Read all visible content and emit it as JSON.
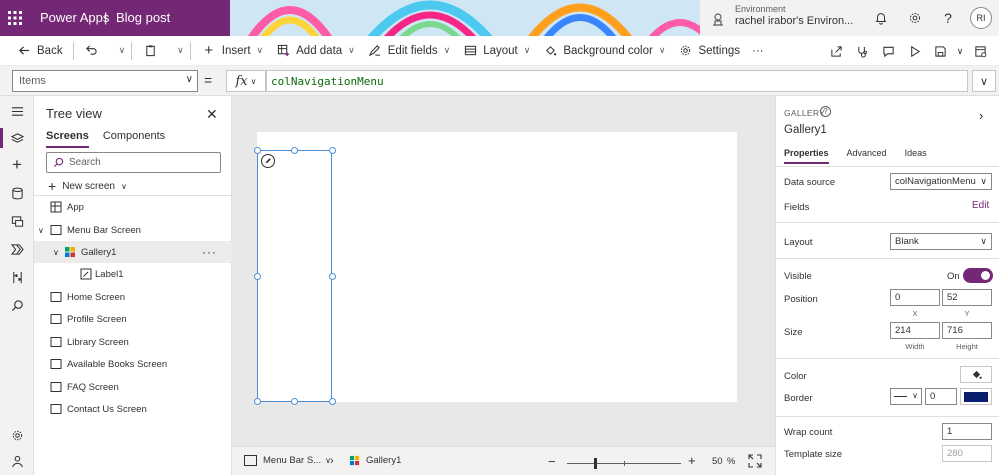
{
  "header": {
    "app_name": "Power Apps",
    "separator": "|",
    "doc_name": "Blog post",
    "environment_label": "Environment",
    "environment_value": "rachel irabor's Environ...",
    "avatar_initials": "RI",
    "brand_color": "#742774"
  },
  "commandbar": {
    "back": "Back",
    "insert": "Insert",
    "add_data": "Add data",
    "edit_fields": "Edit fields",
    "layout": "Layout",
    "background_color": "Background color",
    "settings": "Settings",
    "more": "···"
  },
  "formula": {
    "property": "Items",
    "equals": "=",
    "fx": "fx",
    "value": "colNavigationMenu"
  },
  "tree": {
    "title": "Tree view",
    "tabs": [
      "Screens",
      "Components"
    ],
    "search_placeholder": "Search",
    "new_screen": "New screen",
    "nodes": {
      "app": "App",
      "menu_bar_screen": "Menu Bar Screen",
      "gallery1": "Gallery1",
      "label1": "Label1",
      "home_screen": "Home Screen",
      "profile_screen": "Profile Screen",
      "library_screen": "Library Screen",
      "available_books_screen": "Available Books Screen",
      "faq_screen": "FAQ Screen",
      "contact_us_screen": "Contact Us Screen"
    },
    "more": "···"
  },
  "statusbar": {
    "screen_crumb": "Menu Bar S...",
    "control_crumb": "Gallery1",
    "zoom_value": "50",
    "zoom_unit": "%"
  },
  "properties": {
    "control_type": "GALLERY",
    "control_name": "Gallery1",
    "tabs": [
      "Properties",
      "Advanced",
      "Ideas"
    ],
    "data_source_label": "Data source",
    "data_source_value": "colNavigationMenu",
    "fields_label": "Fields",
    "fields_edit": "Edit",
    "layout_label": "Layout",
    "layout_value": "Blank",
    "visible_label": "Visible",
    "visible_state": "On",
    "position_label": "Position",
    "position_x": "0",
    "position_y": "52",
    "x_label": "X",
    "y_label": "Y",
    "size_label": "Size",
    "size_width": "214",
    "size_height": "716",
    "width_label": "Width",
    "height_label": "Height",
    "color_label": "Color",
    "border_label": "Border",
    "border_width": "0",
    "border_color": "#0a1e6e",
    "wrap_count_label": "Wrap count",
    "wrap_count_value": "1",
    "template_size_label": "Template size",
    "template_size_value": "280"
  }
}
